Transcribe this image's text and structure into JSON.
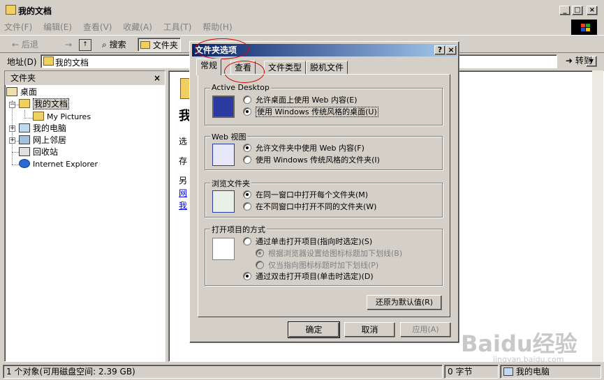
{
  "window": {
    "title": "我的文档",
    "controls": {
      "minimize": "_",
      "maximize": "□",
      "close": "×"
    }
  },
  "menubar": [
    "文件(F)",
    "编辑(E)",
    "查看(V)",
    "收藏(A)",
    "工具(T)",
    "帮助(H)"
  ],
  "toolbar": {
    "back": "后退",
    "forward": "→",
    "search": "搜索",
    "folders": "文件夹"
  },
  "address": {
    "label": "地址(D)",
    "value": "我的文档",
    "go": "转到"
  },
  "tree": {
    "header": "文件夹",
    "close": "×",
    "items": [
      {
        "label": "桌面"
      },
      {
        "label": "我的文档"
      },
      {
        "label": "My Pictures"
      },
      {
        "label": "我的电脑"
      },
      {
        "label": "网上邻居"
      },
      {
        "label": "回收站"
      },
      {
        "label": "Internet Explorer"
      }
    ]
  },
  "content_fragments": {
    "title": "我",
    "line1": "选",
    "line2": "存",
    "line3": "另",
    "link1": "网",
    "link2": "我"
  },
  "statusbar": {
    "objects": "1 个对象(可用磁盘空间: 2.39 GB)",
    "size": "0 字节",
    "location": "我的电脑"
  },
  "dialog": {
    "title": "文件夹选项",
    "help": "?",
    "close": "×",
    "tabs": [
      "常规",
      "查看",
      "文件类型",
      "脱机文件"
    ],
    "groups": [
      {
        "title": "Active Desktop",
        "icon": "monitor-icon",
        "options": [
          {
            "label": "允许桌面上使用 Web 内容(E)",
            "checked": false
          },
          {
            "label": "使用 Windows 传统风格的桌面(U)",
            "checked": true
          }
        ]
      },
      {
        "title": "Web 视图",
        "icon": "web-view-icon",
        "options": [
          {
            "label": "允许文件夹中使用 Web 内容(F)",
            "checked": true
          },
          {
            "label": "使用 Windows 传统风格的文件夹(I)",
            "checked": false
          }
        ]
      },
      {
        "title": "浏览文件夹",
        "icon": "browse-window-icon",
        "options": [
          {
            "label": "在同一窗口中打开每个文件夹(M)",
            "checked": true
          },
          {
            "label": "在不同窗口中打开不同的文件夹(W)",
            "checked": false
          }
        ]
      },
      {
        "title": "打开项目的方式",
        "icon": "click-cursor-icon",
        "options": [
          {
            "label": "通过单击打开项目(指向时选定)(S)",
            "checked": false
          },
          {
            "label": "根据浏览器设置给图标标题加下划线(B)",
            "checked": true,
            "disabled": true
          },
          {
            "label": "仅当指向图标标题时加下划线(P)",
            "checked": false,
            "disabled": true
          },
          {
            "label": "通过双击打开项目(单击时选定)(D)",
            "checked": true
          }
        ]
      }
    ],
    "restore_default": "还原为默认值(R)",
    "buttons": {
      "ok": "确定",
      "cancel": "取消",
      "apply": "应用(A)"
    }
  },
  "watermark": {
    "brand": "Baidu经验",
    "url": "jingyan.baidu.com"
  },
  "colors": {
    "titlebar_active": "#0a246a",
    "face": "#d4d0c8",
    "annotation": "#d40000"
  }
}
